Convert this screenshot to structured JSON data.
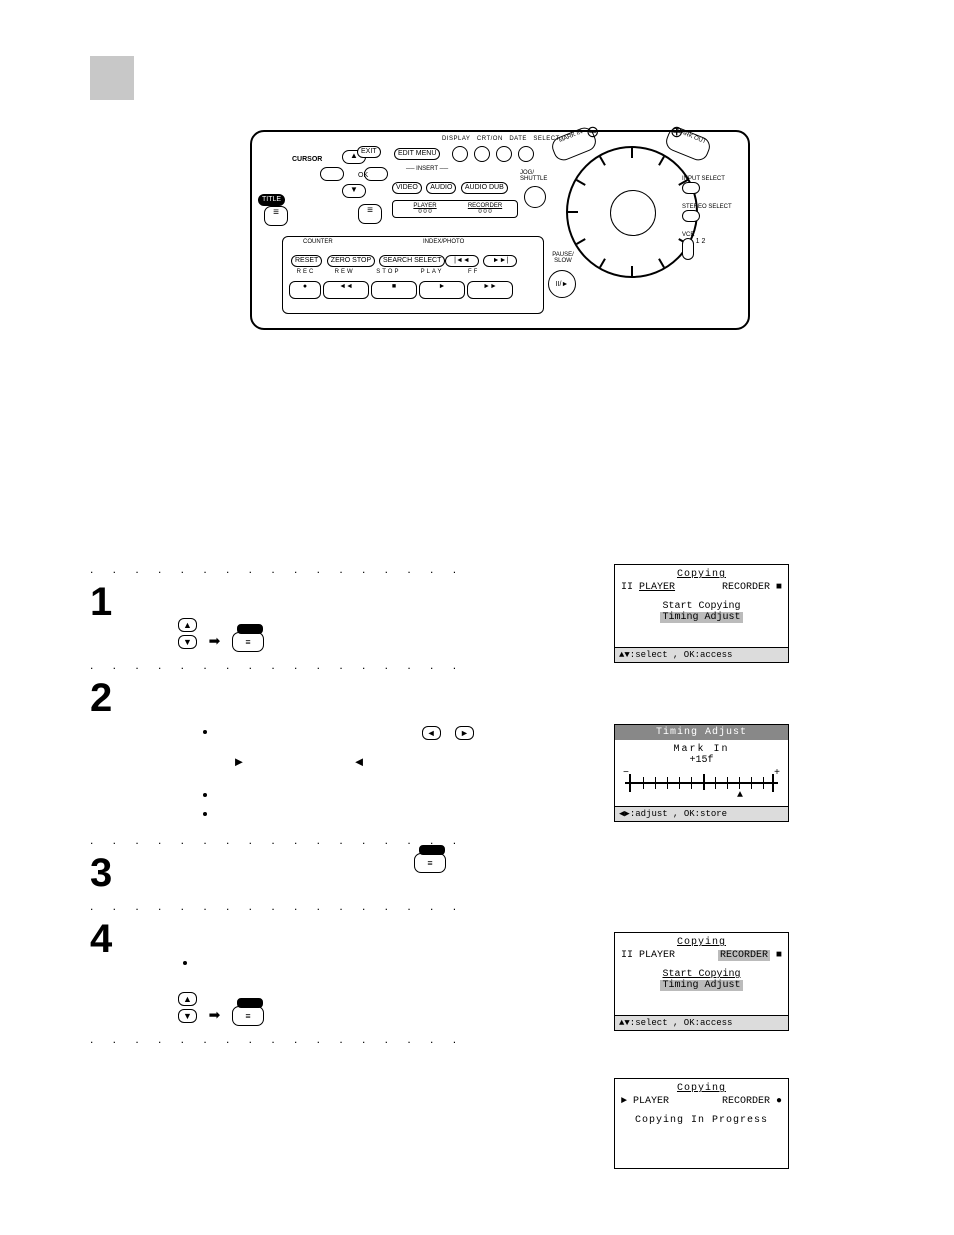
{
  "remote": {
    "cursor_label": "CURSOR",
    "exit_label": "EXIT",
    "ok_label": "OK",
    "title_label": "TITLE",
    "top_row_labels": [
      "DISPLAY",
      "CRT/ON",
      "DATE",
      "SELECT"
    ],
    "edit_menu_label": "EDIT MENU",
    "insert_label": "INSERT",
    "insert_buttons": [
      "VIDEO",
      "AUDIO",
      "AUDIO DUB"
    ],
    "jog_label": "JOG/ SHUTTLE",
    "player_label": "PLAYER",
    "recorder_label": "RECORDER",
    "player_counter": "0 0 0",
    "recorder_counter": "0 0 0",
    "counter_label": "COUNTER",
    "counter_buttons": [
      "RESET",
      "ZERO STOP"
    ],
    "index_label": "INDEX/PHOTO",
    "search_select_label": "SEARCH SELECT",
    "bottom_labels": [
      "REC",
      "REW",
      "STOP",
      "PLAY",
      "FF"
    ],
    "pause_slow_label": "PAUSE/ SLOW",
    "mark_in_label": "MARK IN",
    "mark_out_label": "MARK OUT",
    "input_select_label": "INPUT SELECT",
    "stereo_select_label": "STEREO SELECT",
    "vcr_label": "VCR",
    "vcr_opts": "1 2"
  },
  "steps": {
    "s1": {
      "num": "1"
    },
    "s2": {
      "num": "2",
      "dir_left": "◄",
      "dir_right": "►",
      "play": "►",
      "rew": "◄"
    },
    "s3": {
      "num": "3"
    },
    "s4": {
      "num": "4"
    }
  },
  "arrows": {
    "right": "➡"
  },
  "osd1": {
    "title": "Copying",
    "player": "PLAYER",
    "recorder": "RECORDER",
    "pause": "II",
    "stop": "■",
    "line1": "Start Copying",
    "line2": "Timing Adjust",
    "footer": "▲▼:select , OK:access"
  },
  "osd2": {
    "title": "Timing Adjust",
    "mark": "Mark In",
    "value": "+15f",
    "minus": "−",
    "plus": "+",
    "pointer": "▲",
    "footer": "◀▶:adjust , OK:store"
  },
  "osd3": {
    "title": "Copying",
    "player": "PLAYER",
    "recorder": "RECORDER",
    "pause": "II",
    "stop": "■",
    "line1": "Start Copying",
    "line2": "Timing Adjust",
    "footer": "▲▼:select , OK:access"
  },
  "osd4": {
    "title": "Copying",
    "player": "PLAYER",
    "recorder": "RECORDER",
    "play": "►",
    "rec": "●",
    "line": "Copying In Progress"
  },
  "misc": {
    "updown": "▲▼",
    "up": "▲",
    "down": "▼",
    "fwd": "►►",
    "prev": "|◄◄",
    "next": "►►|",
    "rec_dot": "●",
    "stop_sq": "■",
    "play_tri": "►",
    "rew": "◄◄",
    "pause": "II/►"
  }
}
